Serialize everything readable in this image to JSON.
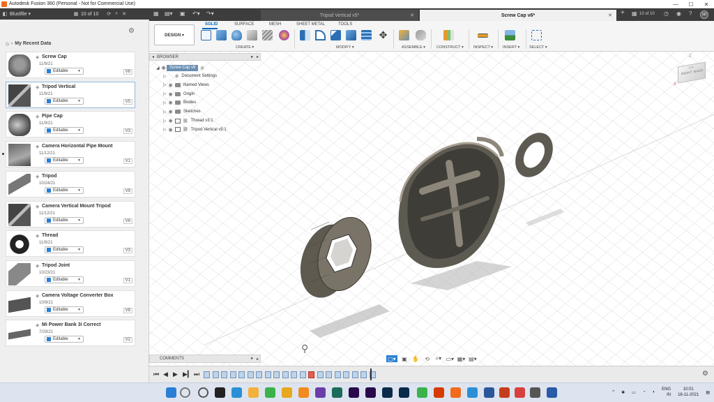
{
  "app": {
    "title": "Autodesk Fusion 360 (Personal - Not for Commercial Use)",
    "window_controls": [
      "—",
      "☐",
      "✕"
    ]
  },
  "data_panel": {
    "team": "Blustfile",
    "page_count": "10 of 10",
    "breadcrumb": "My Recent Data",
    "items": [
      {
        "name": "Screw Cap",
        "date": "11/9/21",
        "permission": "Editable",
        "version": "V6",
        "thumb": "screw-cap",
        "selected": false
      },
      {
        "name": "Tripod Vertical",
        "date": "11/9/21",
        "permission": "Editable",
        "version": "V5",
        "thumb": "bracket",
        "selected": true
      },
      {
        "name": "Pipe Cap",
        "date": "11/9/21",
        "permission": "Editable",
        "version": "V3",
        "thumb": "cylinder",
        "selected": false
      },
      {
        "name": "Camera Horizontal Pipe Mount",
        "date": "11/12/21",
        "permission": "Editable",
        "version": "V1",
        "thumb": "box-mount",
        "selected": false
      },
      {
        "name": "Tripod",
        "date": "10/24/21",
        "permission": "Editable",
        "version": "V9",
        "thumb": "rod",
        "selected": false
      },
      {
        "name": "Camera Vertical Mount Tripod",
        "date": "11/12/21",
        "permission": "Editable",
        "version": "V6",
        "thumb": "bracket",
        "selected": false
      },
      {
        "name": "Thread",
        "date": "11/9/21",
        "permission": "Editable",
        "version": "V3",
        "thumb": "ring",
        "selected": false
      },
      {
        "name": "Tripod Joint",
        "date": "10/23/21",
        "permission": "Editable",
        "version": "V1",
        "thumb": "joint",
        "selected": false
      },
      {
        "name": "Camera Voltage Converter Box",
        "date": "10/9/21",
        "permission": "Editable",
        "version": "V8",
        "thumb": "tray",
        "selected": false
      },
      {
        "name": "Mi Power Bank 3i Correct",
        "date": "7/29/21",
        "permission": "Editable",
        "version": "V2",
        "thumb": "flat",
        "selected": false
      }
    ]
  },
  "tabs": {
    "inactive": "Tripod Vertical v5*",
    "active": "Screw Cap v6*",
    "right_count": "10 of 10",
    "user_initials": "SD"
  },
  "toolbar": {
    "workspace": "DESIGN ▾",
    "tabs": [
      "SOLID",
      "SURFACE",
      "MESH",
      "SHEET METAL",
      "TOOLS"
    ],
    "groups": [
      "CREATE ▾",
      "MODIFY ▾",
      "ASSEMBLE ▾",
      "CONSTRUCT ▾",
      "INSPECT ▾",
      "INSERT ▾",
      "SELECT ▾"
    ]
  },
  "browser": {
    "title": "BROWSER",
    "root": "Screw Cap v6",
    "nodes": [
      "Document Settings",
      "Named Views",
      "Origin",
      "Bodies",
      "Sketches",
      "Thread v3:1",
      "Tripod Vertical v5:1"
    ]
  },
  "viewcube": {
    "top": "TOP",
    "right": "RIGHT",
    "back": "BACK",
    "z": "Z",
    "x": "X"
  },
  "comments": {
    "label": "COMMENTS"
  },
  "taskbar": {
    "lang": "ENG",
    "region": "IN",
    "time": "10:01",
    "date": "18-11-2021"
  },
  "colors": {
    "dark_bar": "#3d3d3d",
    "accent": "#0a66c2",
    "body": "#6b6558"
  }
}
